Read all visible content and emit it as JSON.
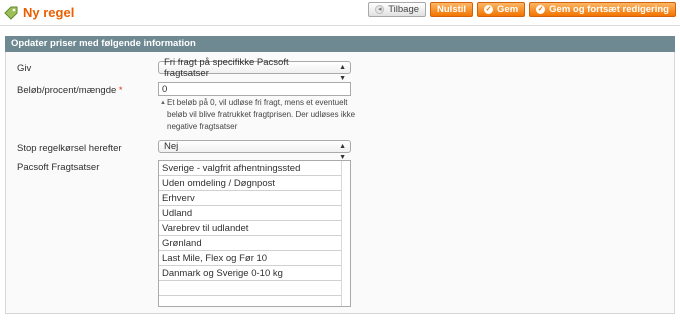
{
  "header": {
    "title": "Ny regel",
    "title_icon": "rule-icon",
    "accent_color": "#eb5e00"
  },
  "buttons": {
    "back": "Tilbage",
    "reset": "Nulstil",
    "save": "Gem",
    "save_continue": "Gem og fortsæt redigering"
  },
  "section": {
    "title": "Opdater priser med følgende information"
  },
  "form": {
    "give": {
      "label": "Giv",
      "value": "Fri fragt på specifikke Pacsoft fragtsatser"
    },
    "amount": {
      "label": "Beløb/procent/mængde",
      "required_mark": "*",
      "value": "0",
      "note": "Et beløb på 0, vil udløse fri fragt, mens et eventuelt beløb vil blive fratrukket fragtprisen. Der udløses ikke negative fragtsatser"
    },
    "stop": {
      "label": "Stop regelkørsel herefter",
      "value": "Nej"
    },
    "rates": {
      "label": "Pacsoft Fragtsatser",
      "options": [
        "Sverige - valgfrit afhentningssted",
        "Uden omdeling / Døgnpost",
        "Erhverv",
        "Udland",
        "Varebrev til udlandet",
        "Grønland",
        "Last Mile, Flex og Før 10",
        "Danmark og Sverige 0-10 kg"
      ]
    }
  }
}
